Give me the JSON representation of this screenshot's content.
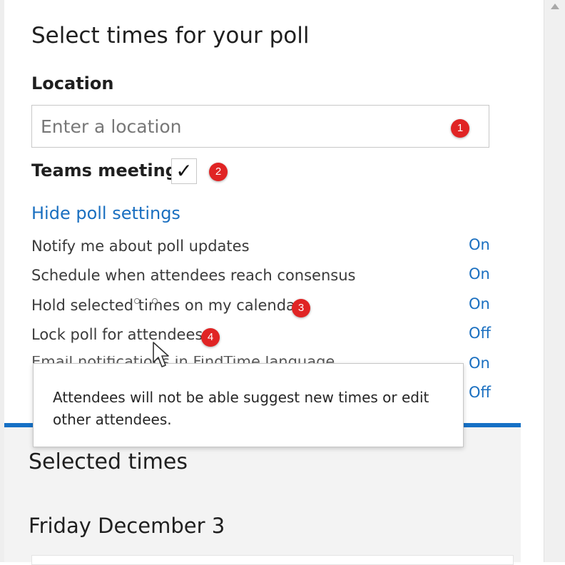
{
  "page": {
    "heading": "Select times for your poll"
  },
  "location": {
    "label": "Location",
    "placeholder": "Enter a location",
    "value": ""
  },
  "teams": {
    "label": "Teams meeting",
    "checked": true,
    "check_glyph": "✓"
  },
  "poll_settings": {
    "toggle_label": "Hide poll settings",
    "items": [
      {
        "label": "Notify me about poll updates",
        "value": "On"
      },
      {
        "label": "Schedule when attendees reach consensus",
        "value": "On"
      },
      {
        "label": "Hold selected times on my calendar",
        "value": "On"
      },
      {
        "label": "Lock poll for attendees",
        "value": "Off"
      },
      {
        "label": "Email notifications in FindTime language",
        "value": "On"
      },
      {
        "label": "",
        "value": "Off"
      }
    ]
  },
  "tooltip": {
    "text": "Attendees will not be able suggest new times or edit other attendees."
  },
  "selected_times": {
    "title": "Selected times",
    "date": "Friday December 3"
  },
  "annotations": [
    "1",
    "2",
    "3",
    "4"
  ],
  "colors": {
    "accent_blue": "#1a6fc0",
    "section_bar": "#1670c5",
    "marker_red": "#e02424"
  },
  "icons": {
    "checkbox": "checkmark-icon",
    "cursor": "mouse-pointer-icon",
    "scroll": "scroll-up-arrow-icon"
  }
}
